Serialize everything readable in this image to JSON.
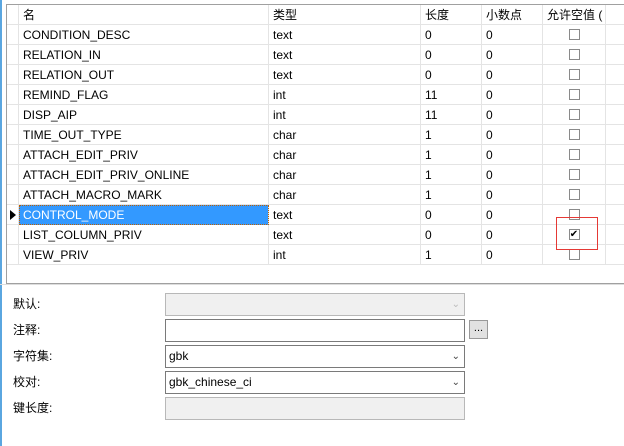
{
  "grid": {
    "headers": [
      "名",
      "类型",
      "长度",
      "小数点",
      "允许空值 ("
    ],
    "rows": [
      {
        "name": "CONDITION_DESC",
        "type": "text",
        "length": "0",
        "decimals": "0",
        "nullable": false
      },
      {
        "name": "RELATION_IN",
        "type": "text",
        "length": "0",
        "decimals": "0",
        "nullable": false
      },
      {
        "name": "RELATION_OUT",
        "type": "text",
        "length": "0",
        "decimals": "0",
        "nullable": false
      },
      {
        "name": "REMIND_FLAG",
        "type": "int",
        "length": "11",
        "decimals": "0",
        "nullable": false
      },
      {
        "name": "DISP_AIP",
        "type": "int",
        "length": "11",
        "decimals": "0",
        "nullable": false
      },
      {
        "name": "TIME_OUT_TYPE",
        "type": "char",
        "length": "1",
        "decimals": "0",
        "nullable": false
      },
      {
        "name": "ATTACH_EDIT_PRIV",
        "type": "char",
        "length": "1",
        "decimals": "0",
        "nullable": false
      },
      {
        "name": "ATTACH_EDIT_PRIV_ONLINE",
        "type": "char",
        "length": "1",
        "decimals": "0",
        "nullable": false
      },
      {
        "name": "ATTACH_MACRO_MARK",
        "type": "char",
        "length": "1",
        "decimals": "0",
        "nullable": false
      },
      {
        "name": "CONTROL_MODE",
        "type": "text",
        "length": "0",
        "decimals": "0",
        "nullable": false,
        "selected": true
      },
      {
        "name": "LIST_COLUMN_PRIV",
        "type": "text",
        "length": "0",
        "decimals": "0",
        "nullable": true
      },
      {
        "name": "VIEW_PRIV",
        "type": "int",
        "length": "1",
        "decimals": "0",
        "nullable": false
      }
    ]
  },
  "form": {
    "default_label": "默认:",
    "default_value": "",
    "comment_label": "注释:",
    "comment_value": "",
    "comment_button": "...",
    "charset_label": "字符集:",
    "charset_value": "gbk",
    "collation_label": "校对:",
    "collation_value": "gbk_chinese_ci",
    "keylen_label": "键长度:",
    "keylen_value": ""
  },
  "colors": {
    "selection": "#3399ff",
    "highlight_box": "#e53935"
  }
}
